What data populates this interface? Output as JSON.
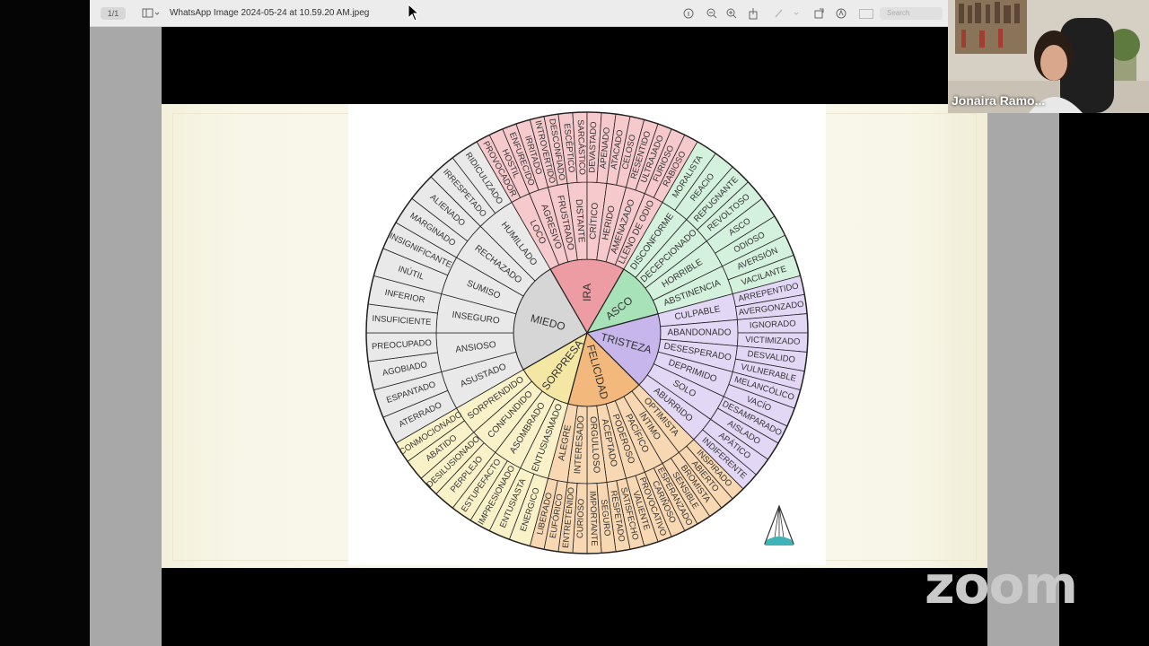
{
  "window": {
    "title": "WhatsApp Image 2024-05-24 at 10.59.20 AM.jpeg",
    "page_indicator": "1/1",
    "search_placeholder": "Search"
  },
  "participant": {
    "name": "Jonaira Ramo..."
  },
  "brand": {
    "zoom_logo": "zoom"
  },
  "wheel": {
    "segments": [
      {
        "core": "IRA",
        "color": "#ee9ca3",
        "light": "#f6c9cc",
        "mid": [
          "LOCO",
          "AGRESIVO",
          "FRUSTRADO",
          "DISTANTE",
          "CRÍTICO",
          "HERIDO",
          "AMENAZADO",
          "LLENO DE ODIO"
        ],
        "outer": [
          "PROVOCADOR",
          "HOSTIL",
          "ENFURECIDO",
          "IRRITADO",
          "INTROVERTIDO",
          "DESCONFIADO",
          "ESCÉPTICO",
          "SARCÁSTICO",
          "DEVASTADO",
          "APENADO",
          "ATACADO",
          "CELOSO",
          "RESENTIDO",
          "ULTRAJADO",
          "FURIOSO",
          "RABIOSO"
        ]
      },
      {
        "core": "ASCO",
        "color": "#a8e2b8",
        "light": "#d3f1dc",
        "mid": [
          "DISCONFORME",
          "DECEPCIONADO",
          "HORRIBLE",
          "ABSTINENCIA"
        ],
        "outer": [
          "MORALISTA",
          "REACIO",
          "REPUGNANTE",
          "REVOLTOSO",
          "ASCO",
          "ODIOSO",
          "AVERSIÓN",
          "VACILANTE"
        ]
      },
      {
        "core": "TRISTEZA",
        "color": "#c7b6ec",
        "light": "#e2d8f6",
        "mid": [
          "CULPABLE",
          "ABANDONADO",
          "DESESPERADO",
          "DEPRIMIDO",
          "SOLO",
          "ABURRIDO"
        ],
        "outer": [
          "ARREPENTIDO",
          "AVERGONZADO",
          "IGNORADO",
          "VICTIMIZADO",
          "DESVALIDO",
          "VULNERABLE",
          "MELANCÓLICO",
          "VACÍO",
          "DESAMPARADO",
          "AISLADO",
          "APÁTICO",
          "INDIFERENTE"
        ]
      },
      {
        "core": "FELICIDAD",
        "color": "#f3b97c",
        "light": "#f8d8b2",
        "mid": [
          "OPTIMISTA",
          "ÍNTIMO",
          "PACÍFICO",
          "PODEROSO",
          "ACEPTADO",
          "ORGULLOSO",
          "INTERESADO",
          "ALEGRE"
        ],
        "outer": [
          "INSPIRADO",
          "ABIERTO",
          "BROMISTA",
          "SENSIBLE",
          "ESPERANZADO",
          "CARIÑOSO",
          "PROVOCATIVO",
          "VALIENTE",
          "SATISFECHO",
          "RESPETADO",
          "SEGURO",
          "IMPORTANTE",
          "CURIOSO",
          "ENTRETENIDO",
          "EUFÓRICO",
          "LIBERADO"
        ]
      },
      {
        "core": "SORPRESA",
        "color": "#f4e7a3",
        "light": "#f9f2c9",
        "mid": [
          "ENTUSIASMADO",
          "ASOMBRADO",
          "CONFUNDIDO",
          "SORPRENDIDO"
        ],
        "outer": [
          "ENERGICO",
          "ENTUSIASTA",
          "IMPRESIONADO",
          "ESTUPEFACTO",
          "PERPLEJO",
          "DESILUSIONADO",
          "ABATIDO",
          "CONMOCIONADO"
        ]
      },
      {
        "core": "MIEDO",
        "color": "#d6d6d6",
        "light": "#e9e9e9",
        "mid": [
          "ASUSTADO",
          "ANSIOSO",
          "INSEGURO",
          "SUMISO",
          "RECHAZADO",
          "HUMILLADO"
        ],
        "outer": [
          "ATERRADO",
          "ESPANTADO",
          "AGOBIADO",
          "PREOCUPADO",
          "INSUFICIENTE",
          "INFERIOR",
          "INÚTIL",
          "INSIGNIFICANTE",
          "MARGINADO",
          "ALIENADO",
          "IRRESPETADO",
          "RIDICULIZADO"
        ]
      }
    ]
  }
}
